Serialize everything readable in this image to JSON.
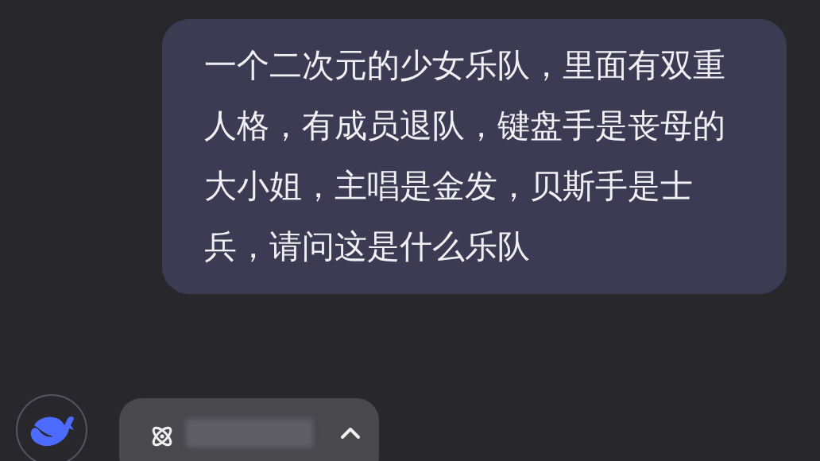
{
  "message": {
    "text": "一个二次元的少女乐队，里面有双重人格，有成员退队，键盘手是丧母的大小姐，主唱是金发，贝斯手是士兵，请问这是什么乐队"
  },
  "reply": {
    "thinking": {
      "expanded": false
    }
  }
}
